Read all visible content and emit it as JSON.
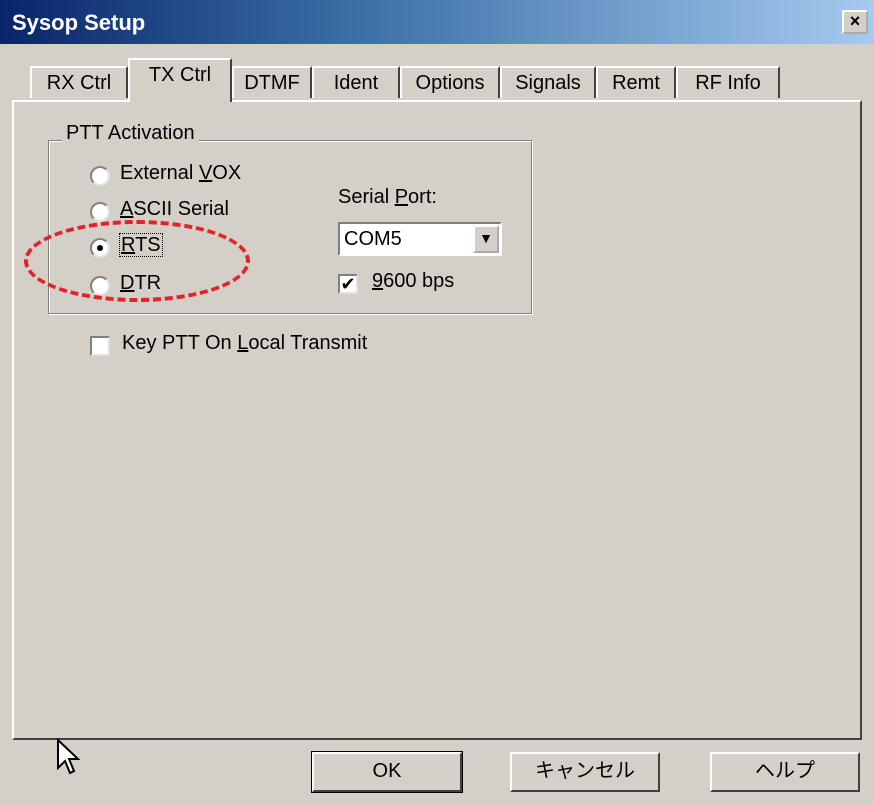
{
  "window": {
    "title": "Sysop Setup",
    "close_glyph": "×"
  },
  "tabs": [
    {
      "label": "RX Ctrl"
    },
    {
      "label": "TX Ctrl",
      "active": true
    },
    {
      "label": "DTMF"
    },
    {
      "label": "Ident"
    },
    {
      "label": "Options"
    },
    {
      "label": "Signals"
    },
    {
      "label": "Remt"
    },
    {
      "label": "RF Info"
    }
  ],
  "ptt": {
    "group_label": "PTT Activation",
    "options": [
      {
        "pre": "External ",
        "key": "V",
        "post": "OX",
        "selected": false
      },
      {
        "pre": "",
        "key": "A",
        "post": "SCII Serial",
        "selected": false
      },
      {
        "pre": "",
        "key": "R",
        "post": "TS",
        "selected": true
      },
      {
        "pre": "",
        "key": "D",
        "post": "TR",
        "selected": false
      }
    ]
  },
  "serial": {
    "label_pre": "Serial ",
    "label_key": "P",
    "label_post": "ort:",
    "value": "COM5",
    "baud_key": "9",
    "baud_post": "600 bps",
    "baud_checked": true
  },
  "local_tx": {
    "pre": "Key PTT On ",
    "key": "L",
    "post": "ocal Transmit",
    "checked": false
  },
  "buttons": {
    "ok": "OK",
    "cancel": "キャンセル",
    "help": "ヘルプ"
  },
  "colors": {
    "accent": "#0a246a",
    "annotation": "#e0242a"
  }
}
